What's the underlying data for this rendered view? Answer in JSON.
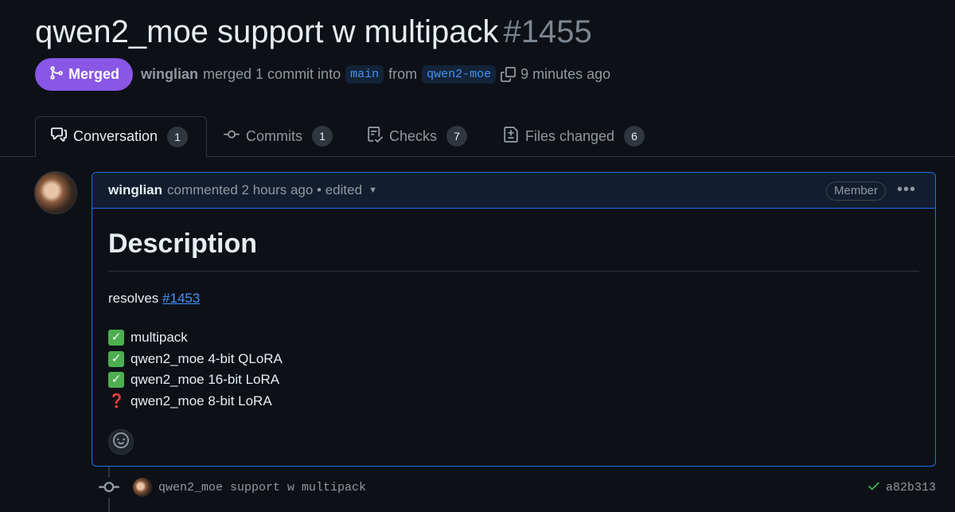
{
  "pr": {
    "title": "qwen2_moe support w multipack",
    "number": "#1455"
  },
  "status": {
    "badge_label": "Merged",
    "user": "winglian",
    "merged_text": "merged 1 commit into",
    "base_branch": "main",
    "from_text": "from",
    "head_branch": "qwen2-moe",
    "time": "9 minutes ago"
  },
  "tabs": [
    {
      "label": "Conversation",
      "count": "1",
      "icon": "comment-discussion-icon",
      "active": true
    },
    {
      "label": "Commits",
      "count": "1",
      "icon": "git-commit-icon",
      "active": false
    },
    {
      "label": "Checks",
      "count": "7",
      "icon": "checklist-icon",
      "active": false
    },
    {
      "label": "Files changed",
      "count": "6",
      "icon": "file-diff-icon",
      "active": false
    }
  ],
  "comment": {
    "user": "winglian",
    "meta": "commented 2 hours ago • edited",
    "role_badge": "Member",
    "heading": "Description",
    "resolves_text": "resolves",
    "resolves_link": "#1453",
    "checklist": [
      {
        "status": "check",
        "text": "multipack"
      },
      {
        "status": "check",
        "text": "qwen2_moe 4-bit QLoRA"
      },
      {
        "status": "check",
        "text": "qwen2_moe 16-bit LoRA"
      },
      {
        "status": "question",
        "text": "qwen2_moe 8-bit LoRA"
      }
    ]
  },
  "commit": {
    "message": "qwen2_moe support w multipack",
    "sha": "a82b313"
  },
  "colors": {
    "background": "#0d1117",
    "merged": "#8957e5",
    "link": "#4493f8",
    "accent_border": "#1f6feb",
    "success": "#3fb950"
  }
}
